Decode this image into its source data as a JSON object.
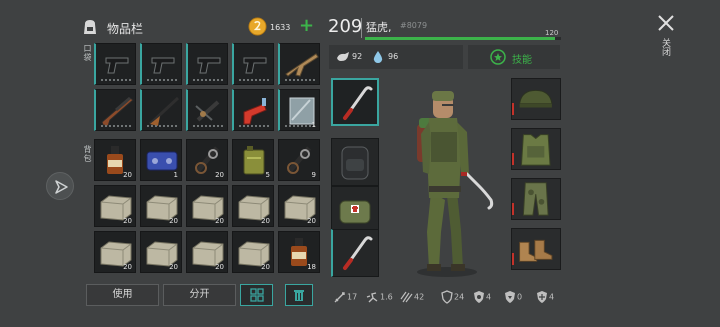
{
  "inventory": {
    "title": "物品栏",
    "coins": "1633",
    "add_label": "+",
    "pocket_label": "口袋",
    "backpack_label": "背包",
    "pocket_slots": [
      {
        "icon": "pistol-icon",
        "count": ""
      },
      {
        "icon": "pistol-icon",
        "count": ""
      },
      {
        "icon": "pistol-icon",
        "count": ""
      },
      {
        "icon": "pistol-icon",
        "count": ""
      },
      {
        "icon": "rifle-icon",
        "count": ""
      },
      {
        "icon": "shotgun-icon",
        "count": ""
      },
      {
        "icon": "hunting-rifle-icon",
        "count": ""
      },
      {
        "icon": "crossbow-icon",
        "count": ""
      },
      {
        "icon": "flare-gun-icon",
        "count": ""
      },
      {
        "icon": "metal-plate-icon",
        "count": "1"
      }
    ],
    "backpack_slots": [
      {
        "icon": "whiskey-bottle-icon",
        "count": "20"
      },
      {
        "icon": "circuit-board-icon",
        "count": "1"
      },
      {
        "icon": "wire-coil-icon",
        "count": "20"
      },
      {
        "icon": "gas-canister-icon",
        "count": "5"
      },
      {
        "icon": "wire-coil-icon",
        "count": "9"
      },
      {
        "icon": "stone-block-icon",
        "count": "20"
      },
      {
        "icon": "stone-block-icon",
        "count": "20"
      },
      {
        "icon": "stone-block-icon",
        "count": "20"
      },
      {
        "icon": "stone-block-icon",
        "count": "20"
      },
      {
        "icon": "stone-block-icon",
        "count": "20"
      },
      {
        "icon": "stone-block-icon",
        "count": "20"
      },
      {
        "icon": "stone-block-icon",
        "count": "20"
      },
      {
        "icon": "stone-block-icon",
        "count": "20"
      },
      {
        "icon": "stone-block-icon",
        "count": "20"
      },
      {
        "icon": "whiskey-bottle-icon",
        "count": "18"
      }
    ],
    "use_label": "使用",
    "split_label": "分开"
  },
  "player": {
    "level": "209",
    "name": "猛虎,",
    "id": "#8079",
    "xp_max": "120",
    "xp_fraction": 0.97,
    "food": "92",
    "water": "96",
    "skills_label": "技能",
    "hands_slots": [
      {
        "icon": "crowbar-icon",
        "count": ""
      },
      {
        "icon": "backpack-icon",
        "count": ""
      },
      {
        "icon": "medkit-bag-icon",
        "count": "16"
      },
      {
        "icon": "crowbar-icon",
        "count": ""
      }
    ],
    "gear": [
      {
        "icon": "military-cap-icon"
      },
      {
        "icon": "body-armor-icon"
      },
      {
        "icon": "camo-pants-icon"
      },
      {
        "icon": "boots-icon"
      }
    ],
    "stats": {
      "attack": "17",
      "speed": "1.6",
      "damage": "42",
      "armor": "24",
      "defense2": "4",
      "defense3": "0",
      "defense4": "4"
    }
  },
  "close_label": "关闭",
  "colors": {
    "accent": "#3aa6a0",
    "xp_green": "#3cb34a",
    "coin": "#e8a82a",
    "red": "#c4322a"
  }
}
